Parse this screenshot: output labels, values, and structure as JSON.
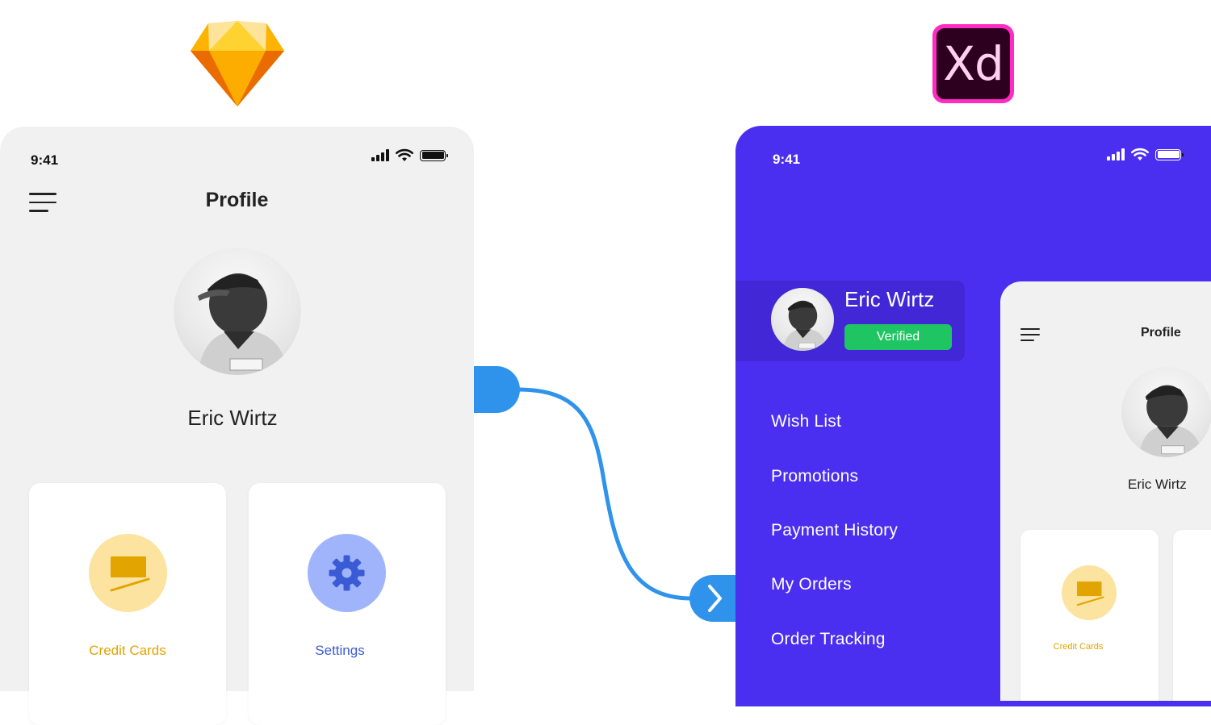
{
  "left_phone": {
    "time": "9:41",
    "title": "Profile",
    "user_name": "Eric Wirtz",
    "cards": [
      {
        "label": "Credit Cards",
        "icon": "credit-card-icon",
        "color": "#e2a400",
        "bg": "#fde3a0"
      },
      {
        "label": "Settings",
        "icon": "gear-icon",
        "color": "#3b5bd6",
        "bg": "#9fb4fb"
      }
    ]
  },
  "xd_phone": {
    "time": "9:41",
    "user_name": "Eric Wirtz",
    "badge": "Verified",
    "menu_items": [
      "Wish List",
      "Promotions",
      "Payment History",
      "My Orders",
      "Order Tracking"
    ],
    "accent": "#4b2ff0",
    "badge_color": "#20c563"
  },
  "mini_phone": {
    "title": "Profile",
    "user_name": "Eric Wirtz",
    "card_label": "Credit Cards"
  },
  "logos": {
    "xd_text": "Xd"
  },
  "connector_color": "#2f93ec"
}
